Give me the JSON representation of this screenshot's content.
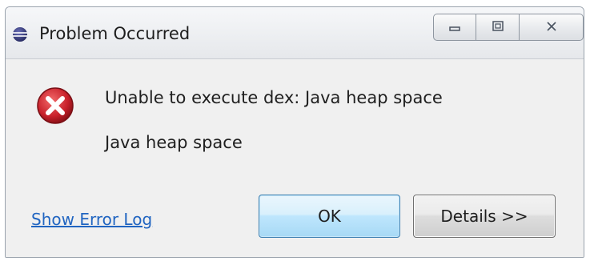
{
  "window": {
    "title": "Problem Occurred",
    "controls": {
      "minimize": "minimize-icon",
      "maximize": "maximize-icon",
      "close": "close-icon"
    }
  },
  "dialog": {
    "icon": "error-icon",
    "message": "Unable to execute dex: Java heap space",
    "reason": "Java heap space"
  },
  "footer": {
    "link": "Show Error Log",
    "ok_label": "OK",
    "details_label": "Details >>"
  },
  "colors": {
    "link": "#2165c1",
    "error_red": "#c8202a",
    "ok_button_border": "#3c7fb1"
  }
}
